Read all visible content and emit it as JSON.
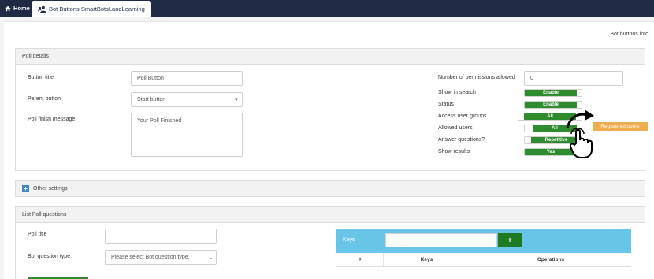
{
  "topbar": {
    "home_label": "Home",
    "tab_label": "Bot Buttons SmartBotsLandLearning"
  },
  "header": {
    "info_link": "Bot buttons info"
  },
  "poll_details": {
    "title": "Poll details",
    "button_title_label": "Button title",
    "button_title_value": "Poll Button",
    "parent_button_label": "Parent button",
    "parent_button_value": "Start button",
    "finish_message_label": "Poll finish message",
    "finish_message_value": "Your Poll Finished",
    "permissions_label": "Number of permissions allowed",
    "permissions_value": "0",
    "show_in_search_label": "Show in search",
    "show_in_search_value": "Enable",
    "status_label": "Status",
    "status_value": "Enable",
    "access_groups_label": "Access user groups",
    "access_groups_value": "All",
    "allowed_users_label": "Allowed users",
    "allowed_users_value": "All",
    "answer_questions_label": "Answer questions?",
    "answer_questions_value": "Repetitive",
    "show_results_label": "Show results",
    "show_results_value": "Yes",
    "registered_users_label": "Registered users"
  },
  "other_settings": {
    "title": "Other settings",
    "icon": "plus-square-icon"
  },
  "poll_questions": {
    "title": "List Poll questions",
    "poll_title_label": "Poll title",
    "poll_title_value": "",
    "question_type_label": "Bot question type",
    "question_type_value": "Please select Bot question type.",
    "keys_label": "Keys",
    "keys_input_value": "",
    "keys_add_symbol": "+",
    "columns": [
      "#",
      "Keys",
      "Operations"
    ]
  },
  "colors": {
    "topbar": "#1f2a44",
    "toggle_green": "#2e8b2e",
    "registered_orange": "#f0ad4e",
    "keys_header_blue": "#69c5e8",
    "add_button_green": "#1e7a23"
  }
}
